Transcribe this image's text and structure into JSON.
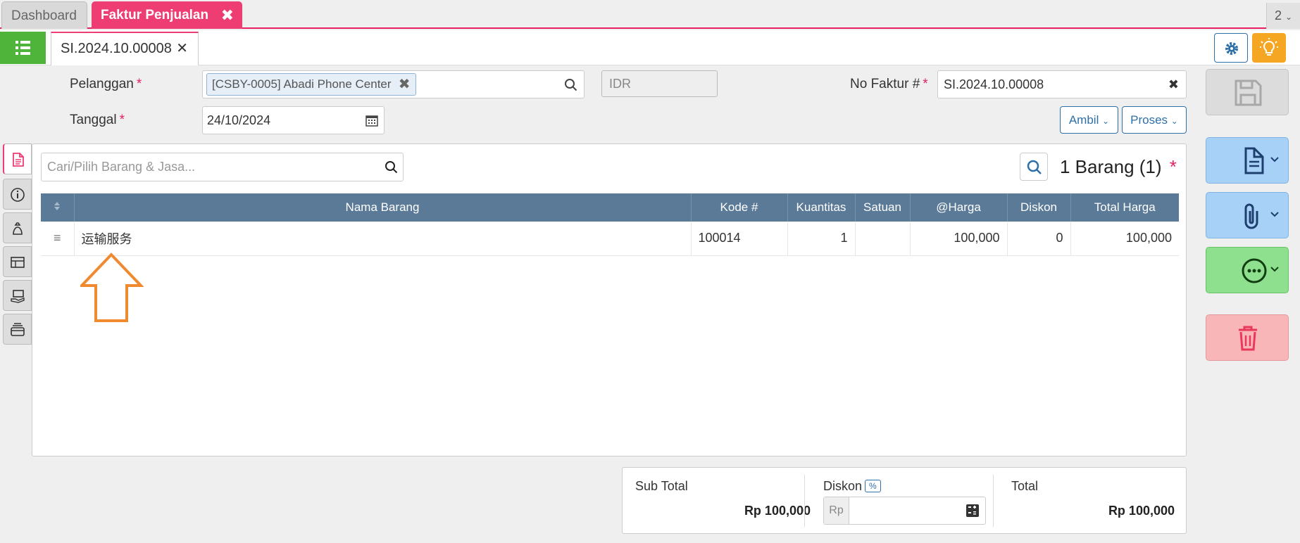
{
  "tabs": {
    "dashboard": "Dashboard",
    "active": "Faktur Penjualan",
    "count": "2"
  },
  "doc_tab": {
    "label": "SI.2024.10.00008"
  },
  "form": {
    "customer_label": "Pelanggan",
    "customer_value": "[CSBY-0005] Abadi Phone Center",
    "currency": "IDR",
    "invoice_no_label": "No Faktur #",
    "invoice_no_value": "SI.2024.10.00008",
    "date_label": "Tanggal",
    "date_value": "24/10/2024",
    "required_mark": "*",
    "ambil_label": "Ambil",
    "proses_label": "Proses"
  },
  "items": {
    "search_placeholder": "Cari/Pilih Barang & Jasa...",
    "count_label": "1 Barang (1)",
    "columns": [
      "Nama Barang",
      "Kode #",
      "Kuantitas",
      "Satuan",
      "@Harga",
      "Diskon",
      "Total Harga"
    ],
    "rows": [
      {
        "name": "运输服务",
        "code": "100014",
        "qty": "1",
        "unit": "",
        "price": "100,000",
        "discount": "0",
        "total": "100,000"
      }
    ]
  },
  "totals": {
    "subtotal_label": "Sub Total",
    "subtotal_value": "Rp 100,000",
    "discount_label": "Diskon",
    "discount_pct": "%",
    "discount_currency": "Rp",
    "total_label": "Total",
    "total_value": "Rp 100,000"
  },
  "colors": {
    "accent": "#ee3d73",
    "green": "#4fb43a",
    "header": "#5a7a97",
    "link": "#2f6fa7",
    "arrow": "#f08a30"
  },
  "icons": [
    "list-icon",
    "close-icon",
    "gear-icon",
    "lightbulb-icon",
    "search-icon",
    "calendar-icon",
    "chevron-down-icon",
    "save-icon",
    "document-icon",
    "paperclip-icon",
    "more-icon",
    "trash-icon",
    "sort-icon",
    "drag-handle-icon",
    "calculator-icon",
    "arrow-up-annotation"
  ]
}
